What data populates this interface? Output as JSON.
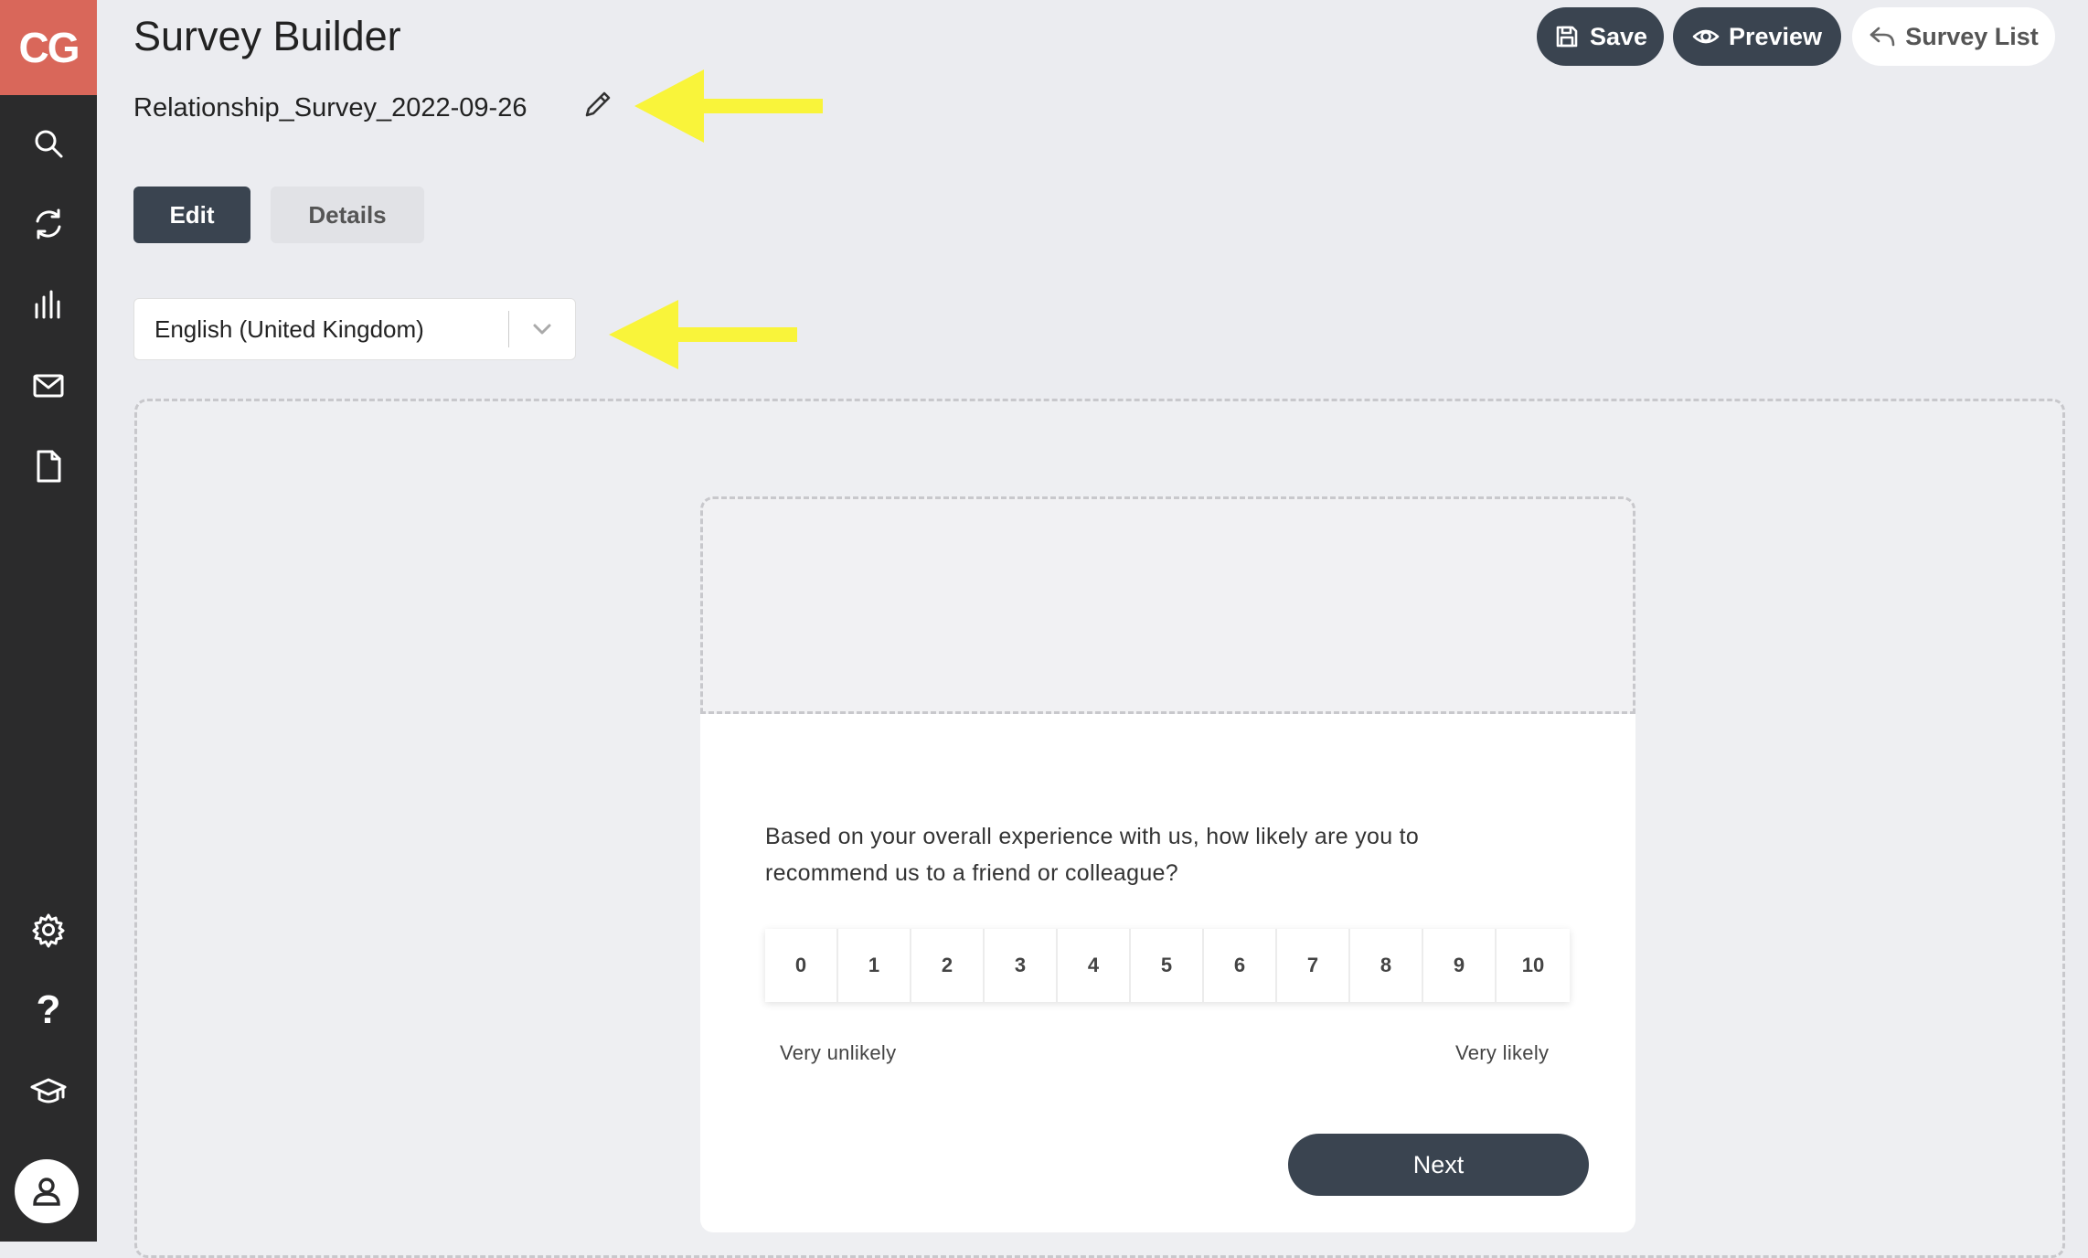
{
  "sidebar": {
    "logo": "CG",
    "items": [
      {
        "icon": "search-icon"
      },
      {
        "icon": "refresh-icon"
      },
      {
        "icon": "bar-chart-icon"
      },
      {
        "icon": "mail-icon"
      },
      {
        "icon": "document-icon"
      },
      {
        "icon": "gear-icon"
      },
      {
        "icon": "help-icon",
        "glyph": "?"
      },
      {
        "icon": "graduation-cap-icon"
      },
      {
        "icon": "user-icon"
      }
    ]
  },
  "header": {
    "title": "Survey Builder",
    "survey_name": "Relationship_Survey_2022-09-26",
    "save_label": "Save",
    "preview_label": "Preview",
    "survey_list_label": "Survey List"
  },
  "tabs": {
    "edit": "Edit",
    "details": "Details"
  },
  "language": {
    "selected": "English (United Kingdom)"
  },
  "colors": {
    "sidebar": "#2b2b2c",
    "logo": "#d9675a",
    "dark_button": "#3a4450",
    "annotation_arrow": "#f9f43a"
  },
  "survey": {
    "question": "Based on your overall experience with us, how likely are you to recommend us to a friend or colleague?",
    "scale": [
      "0",
      "1",
      "2",
      "3",
      "4",
      "5",
      "6",
      "7",
      "8",
      "9",
      "10"
    ],
    "low_label": "Very unlikely",
    "high_label": "Very likely",
    "next_label": "Next"
  }
}
